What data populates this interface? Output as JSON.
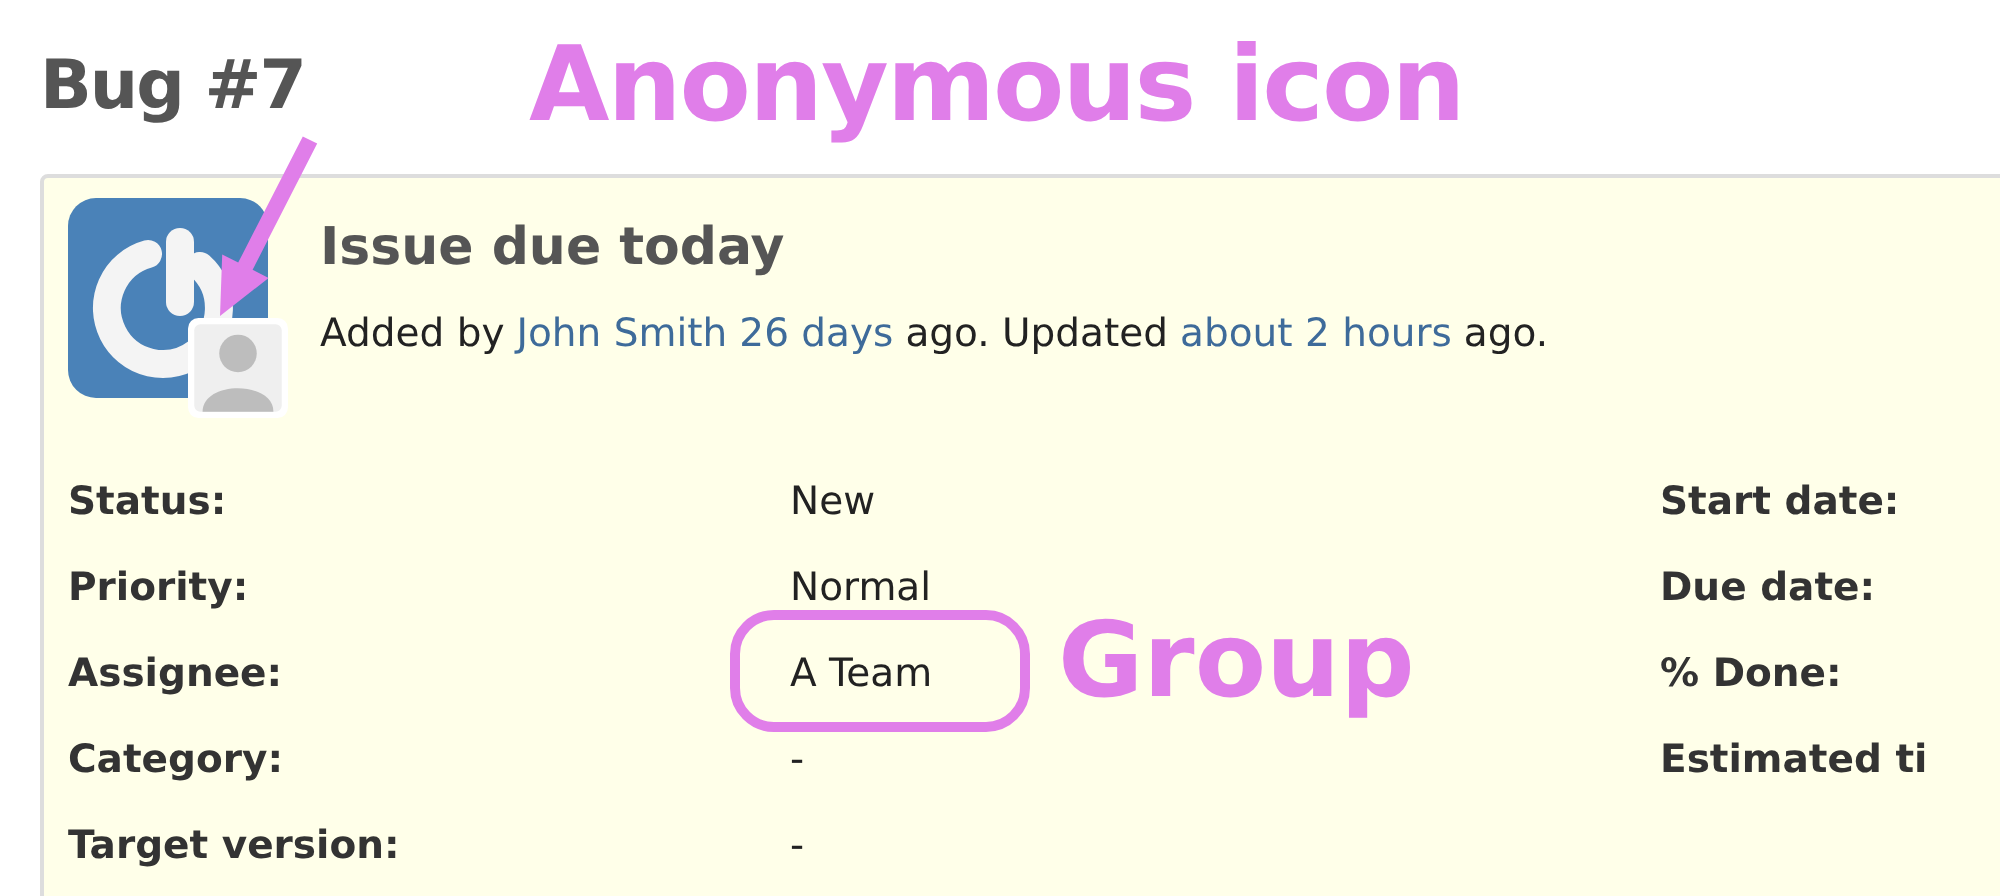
{
  "heading": "Bug #7",
  "callouts": [
    {
      "kind": "arrow",
      "text": "Anonymous icon"
    }
  ],
  "issue": {
    "subject": "Issue due today",
    "author_line": {
      "prefix": "Added by",
      "author": "John Smith",
      "created": "26 days",
      "middle": "ago. Updated",
      "updated": "about 2 hours",
      "suffix": "ago."
    },
    "attributes_left": [
      {
        "label": "Status:",
        "value": "New",
        "circled": false
      },
      {
        "label": "Priority:",
        "value": "Normal",
        "circled": false
      },
      {
        "label": "Assignee:",
        "value": "A Team",
        "circled": true,
        "note": "Group"
      },
      {
        "label": "Category:",
        "value": "-",
        "circled": false
      },
      {
        "label": "Target version:",
        "value": "-",
        "circled": false
      }
    ],
    "attributes_right": [
      {
        "label": "Start date:"
      },
      {
        "label": "Due date:"
      },
      {
        "label": "% Done:"
      },
      {
        "label": "Estimated ti"
      }
    ]
  }
}
